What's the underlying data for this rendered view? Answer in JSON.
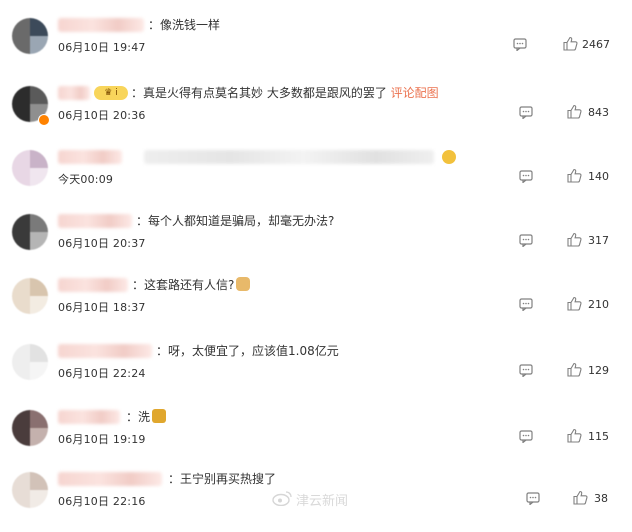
{
  "colors": {
    "link": "#eb7350",
    "text": "#333333",
    "badge": "#ff8200"
  },
  "comments": [
    {
      "text": "：像洗钱一样",
      "time": "06月10日 19:47",
      "likes": "2467"
    },
    {
      "text": "：真是火得有点莫名其妙 大多数都是跟风的罢了",
      "link": "评论配图",
      "time": "06月10日 20:36",
      "likes": "843"
    },
    {
      "text": "",
      "time": "今天00:09",
      "likes": "140"
    },
    {
      "text": "：每个人都知道是骗局，却毫无办法?",
      "time": "06月10日 20:37",
      "likes": "317"
    },
    {
      "text": "：这套路还有人信?",
      "time": "06月10日 18:37",
      "likes": "210"
    },
    {
      "text": "：呀，太便宜了，应该值1.08亿元",
      "time": "06月10日 22:24",
      "likes": "129"
    },
    {
      "text": "：洗",
      "time": "06月10日 19:19",
      "likes": "115"
    },
    {
      "text": "：王宁别再买热搜了",
      "time": "06月10日 22:16",
      "likes": "38"
    }
  ],
  "watermark": "津云新闻",
  "icons": {
    "reply": "comment-icon",
    "like": "thumbs-up-icon"
  }
}
